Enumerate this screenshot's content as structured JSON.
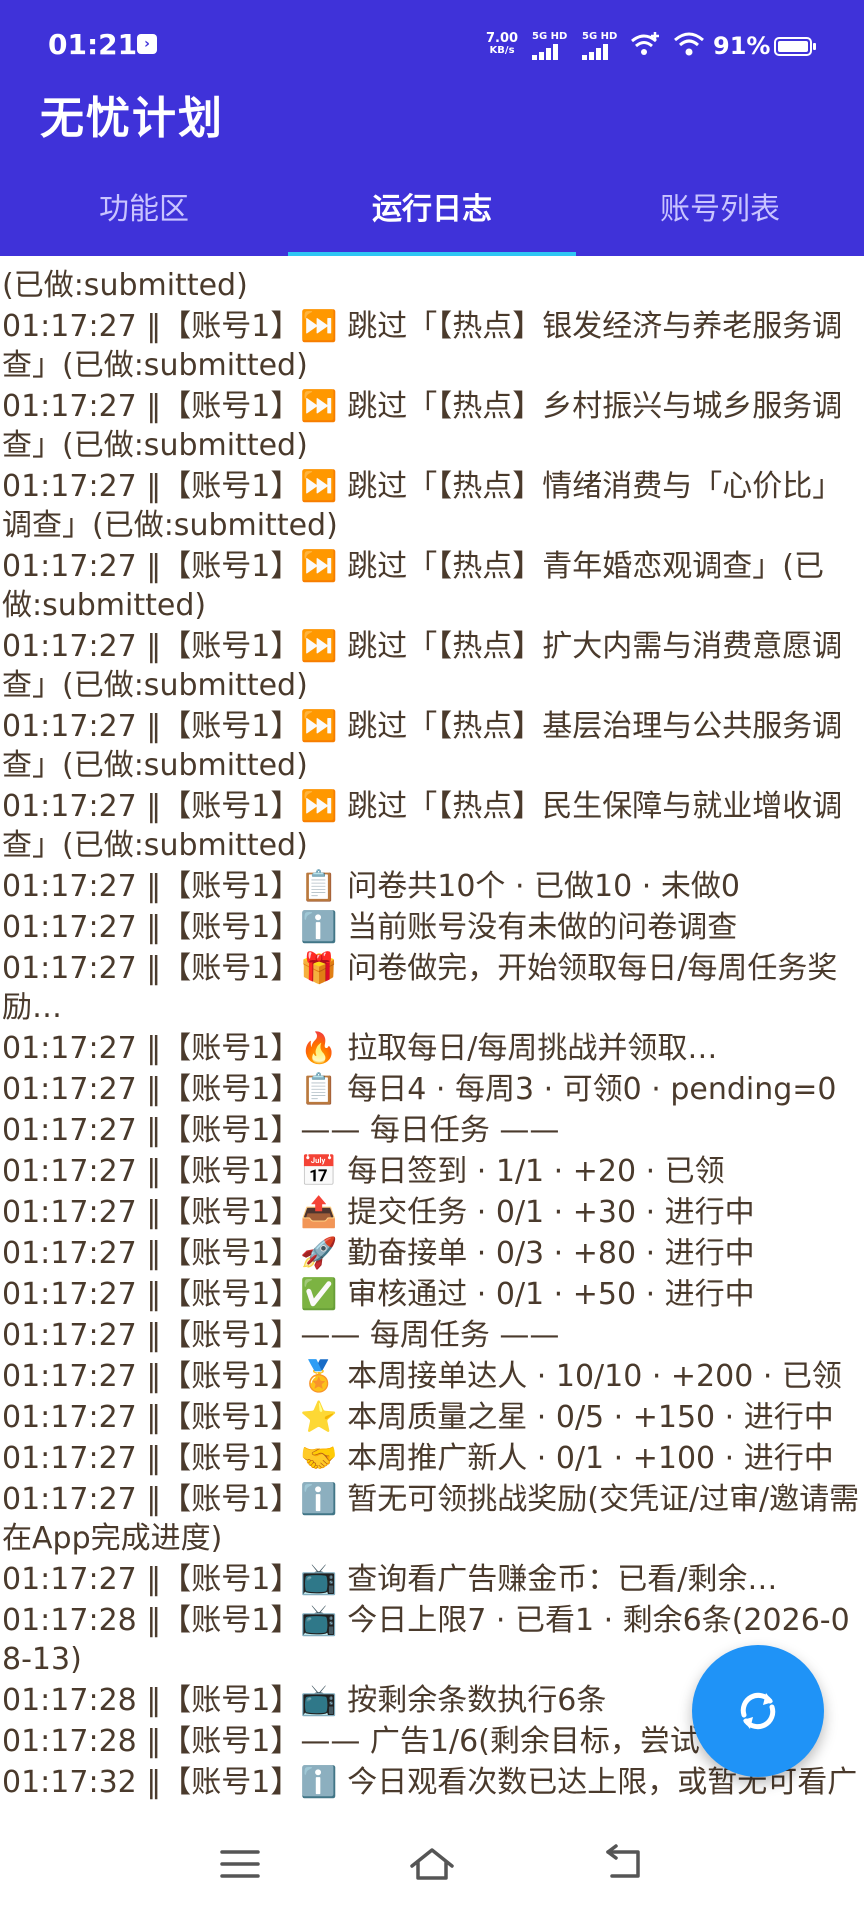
{
  "status": {
    "time": "01:21",
    "speed_value": "7.00",
    "speed_unit": "KB/s",
    "net1": "5G HD",
    "net2": "5G HD",
    "battery": "91%"
  },
  "app": {
    "title": "无忧计划"
  },
  "tabs": [
    {
      "label": "功能区"
    },
    {
      "label": "运行日志"
    },
    {
      "label": "账号列表"
    }
  ],
  "log": [
    "(已做:submitted)",
    " 01:17:27 ‖【账号1】⏭️ 跳过「【热点】银发经济与养老服务调查」(已做:submitted)",
    " 01:17:27 ‖【账号1】⏭️ 跳过「【热点】乡村振兴与城乡服务调查」(已做:submitted)",
    " 01:17:27 ‖【账号1】⏭️ 跳过「【热点】情绪消费与「心价比」调查」(已做:submitted)",
    " 01:17:27 ‖【账号1】⏭️ 跳过「【热点】青年婚恋观调查」(已做:submitted)",
    " 01:17:27 ‖【账号1】⏭️ 跳过「【热点】扩大内需与消费意愿调查」(已做:submitted)",
    " 01:17:27 ‖【账号1】⏭️ 跳过「【热点】基层治理与公共服务调查」(已做:submitted)",
    " 01:17:27 ‖【账号1】⏭️ 跳过「【热点】民生保障与就业增收调查」(已做:submitted)",
    " 01:17:27 ‖【账号1】📋 问卷共10个 · 已做10 · 未做0",
    " 01:17:27 ‖【账号1】ℹ️ 当前账号没有未做的问卷调查",
    " 01:17:27 ‖【账号1】🎁 问卷做完，开始领取每日/每周任务奖励…",
    " 01:17:27 ‖【账号1】🔥 拉取每日/每周挑战并领取…",
    " 01:17:27 ‖【账号1】📋 每日4 · 每周3 · 可领0 · pending=0",
    " 01:17:27 ‖【账号1】—— 每日任务 ——",
    " 01:17:27 ‖【账号1】📅 每日签到 · 1/1 · +20 · 已领",
    " 01:17:27 ‖【账号1】📤 提交任务 · 0/1 · +30 · 进行中",
    " 01:17:27 ‖【账号1】🚀 勤奋接单 · 0/3 · +80 · 进行中",
    " 01:17:27 ‖【账号1】✅ 审核通过 · 0/1 · +50 · 进行中",
    " 01:17:27 ‖【账号1】—— 每周任务 ——",
    " 01:17:27 ‖【账号1】🏅 本周接单达人 · 10/10 · +200 · 已领",
    " 01:17:27 ‖【账号1】⭐ 本周质量之星 · 0/5 · +150 · 进行中",
    " 01:17:27 ‖【账号1】🤝 本周推广新人 · 0/1 · +100 · 进行中",
    " 01:17:27 ‖【账号1】ℹ️ 暂无可领挑战奖励(交凭证/过审/邀请需在App完成进度)",
    " 01:17:27 ‖【账号1】📺 查询看广告赚金币：已看/剩余…",
    " 01:17:28 ‖【账号1】📺 今日上限7 · 已看1 · 剩余6条(2026-08-13)",
    " 01:17:28 ‖【账号1】📺 按剩余条数执行6条",
    " 01:17:28 ‖【账号1】—— 广告1/6(剩余目标，尝试",
    " 01:17:32 ‖【账号1】ℹ️ 今日观看次数已达上限，或暂无可看广"
  ],
  "icons": {
    "fab": "refresh-icon",
    "nav_menu": "menu-icon",
    "nav_home": "home-icon",
    "nav_back": "back-icon"
  },
  "colors": {
    "header": "#3f32d9",
    "tab_indicator": "#2fc6f4",
    "fab": "#1f93f7",
    "log_text": "#4a3a2c"
  }
}
